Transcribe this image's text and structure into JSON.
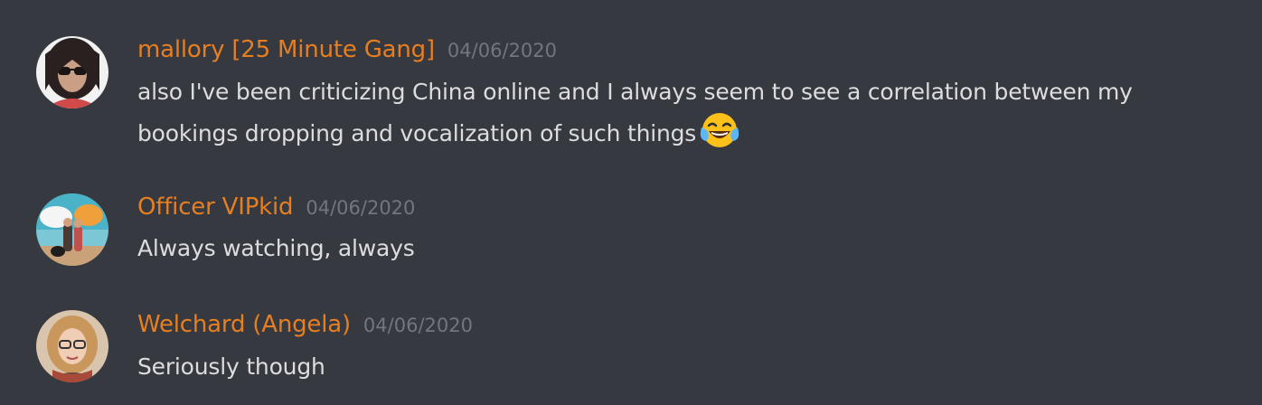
{
  "messages": [
    {
      "username": "mallory [25 Minute Gang]",
      "timestamp": "04/06/2020",
      "text": "also I've been criticizing China online and I always seem to see a correlation between my bookings dropping and vocalization of such things",
      "emoji": "joy-emoji",
      "username_color": "#e67e22"
    },
    {
      "username": "Officer VIPkid",
      "timestamp": "04/06/2020",
      "text": "Always watching, always",
      "username_color": "#e67e22"
    },
    {
      "username": "Welchard (Angela)",
      "timestamp": "04/06/2020",
      "text": "Seriously though",
      "username_color": "#e67e22"
    }
  ],
  "theme": {
    "background": "#36393f",
    "text": "#dcddde",
    "muted": "#72767d"
  }
}
